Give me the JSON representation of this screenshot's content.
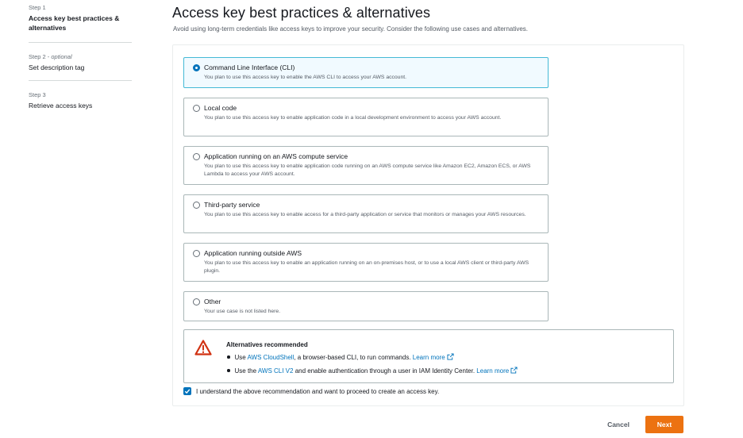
{
  "steps": [
    {
      "number": "Step 1",
      "optional": "",
      "title": "Access key best practices & alternatives",
      "active": true
    },
    {
      "number": "Step 2 -",
      "optional": "optional",
      "title": "Set description tag",
      "active": false
    },
    {
      "number": "Step 3",
      "optional": "",
      "title": "Retrieve access keys",
      "active": false
    }
  ],
  "header": {
    "title": "Access key best practices & alternatives",
    "description": "Avoid using long-term credentials like access keys to improve your security. Consider the following use cases and alternatives."
  },
  "use_cases": [
    {
      "title": "Command Line Interface (CLI)",
      "description": "You plan to use this access key to enable the AWS CLI to access your AWS account.",
      "selected": true
    },
    {
      "title": "Local code",
      "description": "You plan to use this access key to enable application code in a local development environment to access your AWS account.",
      "selected": false
    },
    {
      "title": "Application running on an AWS compute service",
      "description": "You plan to use this access key to enable application code running on an AWS compute service like Amazon EC2, Amazon ECS, or AWS Lambda to access your AWS account.",
      "selected": false
    },
    {
      "title": "Third-party service",
      "description": "You plan to use this access key to enable access for a third-party application or service that monitors or manages your AWS resources.",
      "selected": false
    },
    {
      "title": "Application running outside AWS",
      "description": "You plan to use this access key to enable an application running on an on-premises host, or to use a local AWS client or third-party AWS plugin.",
      "selected": false
    },
    {
      "title": "Other",
      "description": "Your use case is not listed here.",
      "selected": false
    }
  ],
  "alert": {
    "icon": "warning-icon",
    "title": "Alternatives recommended",
    "items": [
      {
        "prefix": "Use ",
        "link": "AWS CloudShell",
        "suffix": ", a browser-based CLI, to run commands.",
        "learn_more": "Learn more"
      },
      {
        "prefix": "Use the ",
        "link": "AWS CLI V2",
        "suffix": " and enable authentication through a user in IAM Identity Center.",
        "learn_more": "Learn more"
      }
    ]
  },
  "acknowledgement": {
    "label": "I understand the above recommendation and want to proceed to create an access key.",
    "checked": true
  },
  "footer": {
    "cancel_label": "Cancel",
    "next_label": "Next"
  },
  "colors": {
    "primary_button": "#ec7211",
    "link": "#0073bb",
    "selected_border": "#44b9d6",
    "selected_bg": "#f1faff",
    "warning": "#d13212"
  }
}
